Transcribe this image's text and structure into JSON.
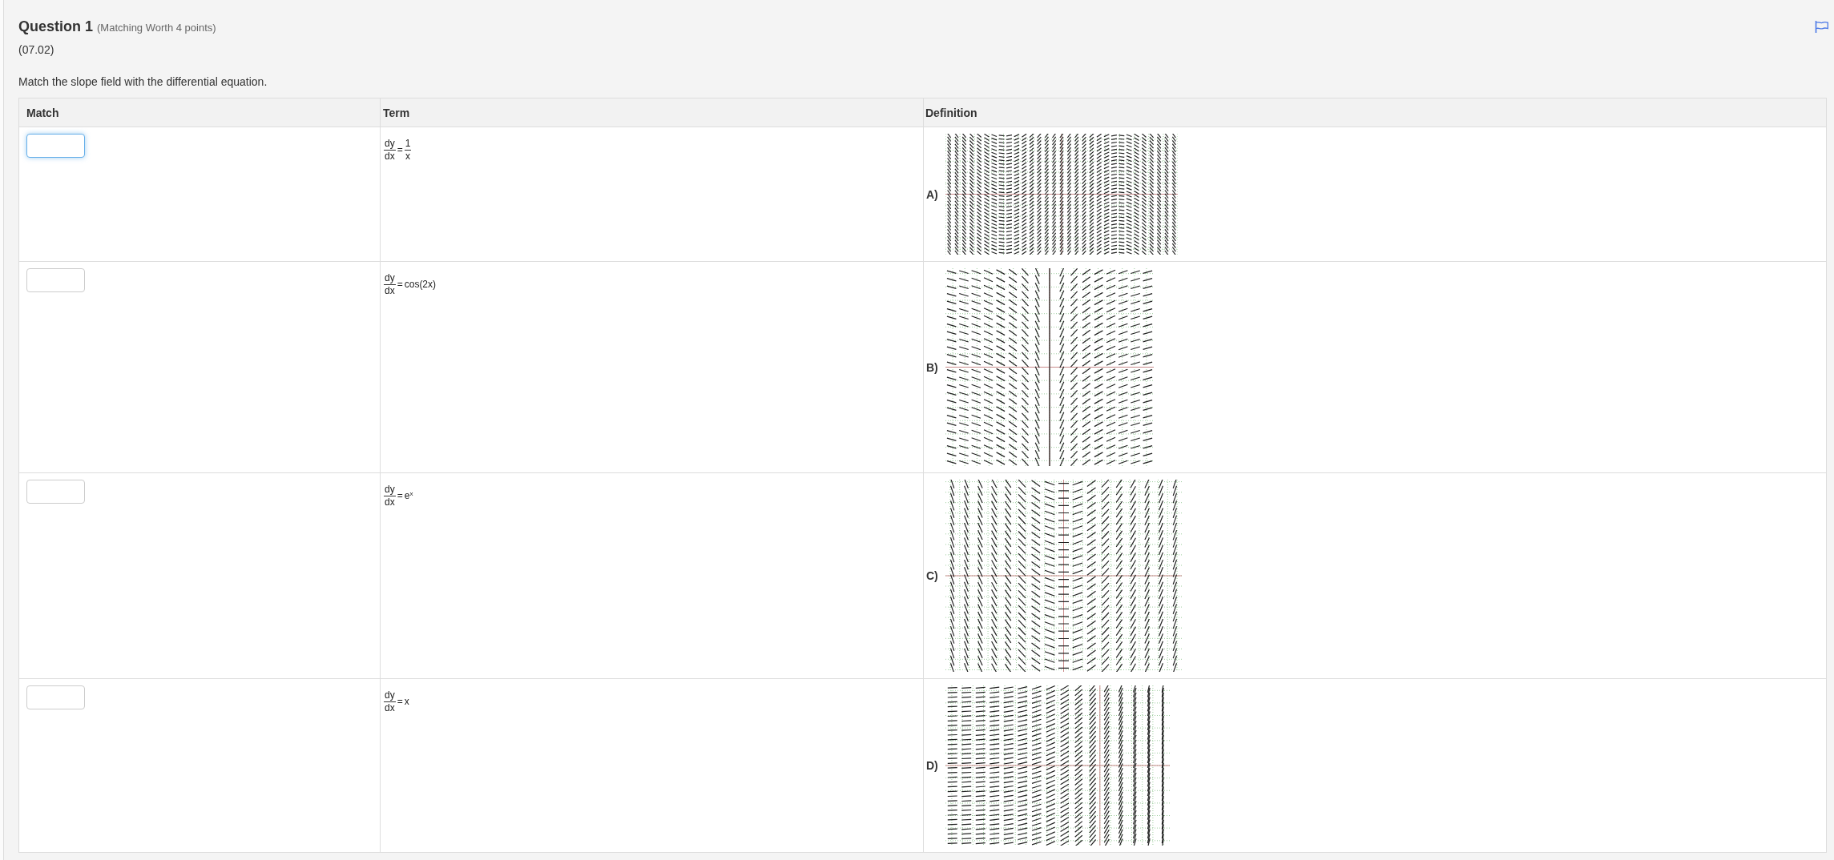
{
  "question": {
    "title": "Question 1",
    "meta": "(Matching Worth 4 points)",
    "code": "(07.02)",
    "prompt": "Match the slope field with the differential equation."
  },
  "table": {
    "columns": [
      "Match",
      "Term",
      "Definition"
    ],
    "rows": [
      {
        "match": {
          "focused": true
        },
        "term": {
          "lhs": {
            "numerator": "dy",
            "denominator": "dx"
          },
          "operator": "=",
          "rhs": {
            "kind": "fraction",
            "numerator": "1",
            "denominator": "x"
          }
        },
        "definition": {
          "label": "A)",
          "kind": "cosine"
        }
      },
      {
        "match": {
          "focused": false
        },
        "term": {
          "lhs": {
            "numerator": "dy",
            "denominator": "dx"
          },
          "operator": "=",
          "rhs": {
            "kind": "text",
            "text": "cos(2x)"
          }
        },
        "definition": {
          "label": "B)",
          "kind": "reciprocal"
        }
      },
      {
        "match": {
          "focused": false
        },
        "term": {
          "lhs": {
            "numerator": "dy",
            "denominator": "dx"
          },
          "operator": "=",
          "rhs": {
            "kind": "text",
            "text": "e$^{x}$"
          }
        },
        "definition": {
          "label": "C)",
          "kind": "linear"
        }
      },
      {
        "match": {
          "focused": false
        },
        "term": {
          "lhs": {
            "numerator": "dy",
            "denominator": "dx"
          },
          "operator": "=",
          "rhs": {
            "kind": "text",
            "text": "x"
          }
        },
        "definition": {
          "label": "D)",
          "kind": "exponential"
        }
      }
    ]
  }
}
